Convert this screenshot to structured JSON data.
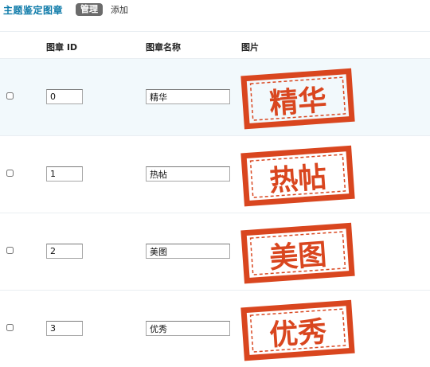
{
  "header": {
    "title": "主题鉴定图章",
    "tab_manage": "管理",
    "tab_add": "添加"
  },
  "columns": {
    "id": "图章 ID",
    "name": "图章名称",
    "image": "图片"
  },
  "rows": [
    {
      "id": "0",
      "name": "精华",
      "stamp_text": "精华"
    },
    {
      "id": "1",
      "name": "热帖",
      "stamp_text": "热帖"
    },
    {
      "id": "2",
      "name": "美图",
      "stamp_text": "美图"
    },
    {
      "id": "3",
      "name": "优秀",
      "stamp_text": "优秀"
    }
  ],
  "colors": {
    "title": "#0b79a8",
    "stamp_red": "#d9461f",
    "highlight_row": "#f2f9fc"
  }
}
